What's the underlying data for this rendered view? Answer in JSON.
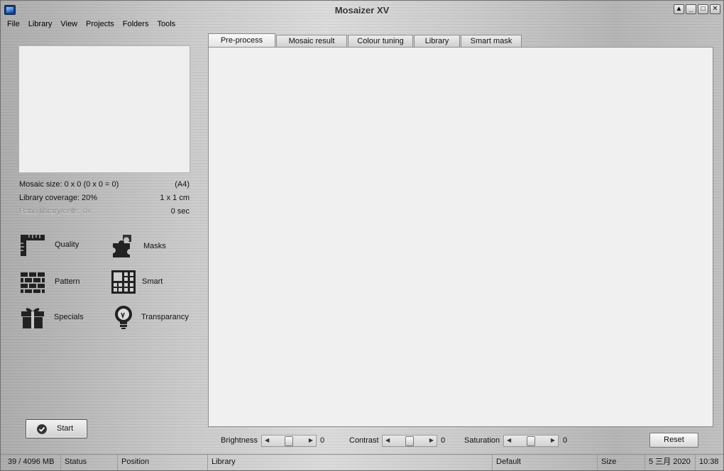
{
  "window": {
    "title": "Mosaizer XV",
    "buttons": [
      "▲",
      "_",
      "□",
      "✕"
    ]
  },
  "menu": [
    "File",
    "Library",
    "View",
    "Projects",
    "Folders",
    "Tools"
  ],
  "info": {
    "mosaic_size": "Mosaic size: 0 x 0  (0 x 0 = 0)",
    "paper": "(A4)",
    "library_coverage": "Library coverage: 20%",
    "cell_size": "1 x 1 cm",
    "ratio": "Ratio library/cells: 0x",
    "time": "0 sec"
  },
  "tools": [
    {
      "label": "Quality",
      "icon": "ruler-icon"
    },
    {
      "label": "Masks",
      "icon": "puzzle-icon"
    },
    {
      "label": "Pattern",
      "icon": "bricks-icon"
    },
    {
      "label": "Smart",
      "icon": "grid-icon"
    },
    {
      "label": "Specials",
      "icon": "gift-icon"
    },
    {
      "label": "Transparancy",
      "icon": "lightbulb-icon"
    }
  ],
  "start_label": "Start",
  "tabs": [
    "Pre-process",
    "Mosaic result",
    "Colour tuning",
    "Library",
    "Smart mask"
  ],
  "active_tab": "Pre-process",
  "adjustments": {
    "brightness": {
      "label": "Brightness",
      "value": "0"
    },
    "contrast": {
      "label": "Contrast",
      "value": "0"
    },
    "saturation": {
      "label": "Saturation",
      "value": "0"
    },
    "reset_label": "Reset"
  },
  "status": {
    "memory": "39 / 4096 MB",
    "status": "Status",
    "position": "Position",
    "library": "Library",
    "default": "Default",
    "size": "Size",
    "date": "5 三月 2020",
    "time": "10:38"
  }
}
